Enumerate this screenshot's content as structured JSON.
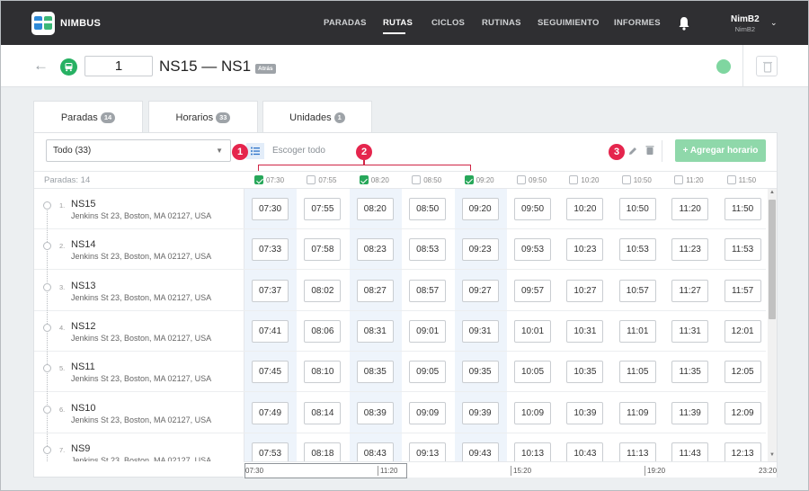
{
  "app": {
    "name": "NIMBUS"
  },
  "nav": {
    "items": [
      "PARADAS",
      "RUTAS",
      "CICLOS",
      "RUTINAS",
      "SEGUIMIENTO",
      "INFORMES"
    ],
    "active": "RUTAS"
  },
  "user": {
    "name": "NimB2",
    "sub": "NimB2"
  },
  "route": {
    "number": "1",
    "name": "NS15 — NS1",
    "direction": "Atrás",
    "status_color": "#7fd6a0"
  },
  "tabs": [
    {
      "label": "Paradas",
      "count": "14"
    },
    {
      "label": "Horarios",
      "count": "33"
    },
    {
      "label": "Unidades",
      "count": "1"
    }
  ],
  "active_tab": "Unidades",
  "toolbar": {
    "filter_value": "Todo (33)",
    "select_all": "Escoger todo",
    "add_label": "+ Agregar horario"
  },
  "markers": [
    "1",
    "2",
    "3"
  ],
  "grid": {
    "stops_label": "Paradas: 14",
    "columns": [
      {
        "time": "07:30",
        "checked": true
      },
      {
        "time": "07:55",
        "checked": false
      },
      {
        "time": "08:20",
        "checked": true
      },
      {
        "time": "08:50",
        "checked": false
      },
      {
        "time": "09:20",
        "checked": true
      },
      {
        "time": "09:50",
        "checked": false
      },
      {
        "time": "10:20",
        "checked": false
      },
      {
        "time": "10:50",
        "checked": false
      },
      {
        "time": "11:20",
        "checked": false
      },
      {
        "time": "11:50",
        "checked": false
      }
    ],
    "stops": [
      {
        "num": "1.",
        "name": "NS15",
        "address": "Jenkins St 23, Boston, MA 02127, USA",
        "times": [
          "07:30",
          "07:55",
          "08:20",
          "08:50",
          "09:20",
          "09:50",
          "10:20",
          "10:50",
          "11:20",
          "11:50"
        ]
      },
      {
        "num": "2.",
        "name": "NS14",
        "address": "Jenkins St 23, Boston, MA 02127, USA",
        "times": [
          "07:33",
          "07:58",
          "08:23",
          "08:53",
          "09:23",
          "09:53",
          "10:23",
          "10:53",
          "11:23",
          "11:53"
        ]
      },
      {
        "num": "3.",
        "name": "NS13",
        "address": "Jenkins St 23, Boston, MA 02127, USA",
        "times": [
          "07:37",
          "08:02",
          "08:27",
          "08:57",
          "09:27",
          "09:57",
          "10:27",
          "10:57",
          "11:27",
          "11:57"
        ]
      },
      {
        "num": "4.",
        "name": "NS12",
        "address": "Jenkins St 23, Boston, MA 02127, USA",
        "times": [
          "07:41",
          "08:06",
          "08:31",
          "09:01",
          "09:31",
          "10:01",
          "10:31",
          "11:01",
          "11:31",
          "12:01"
        ]
      },
      {
        "num": "5.",
        "name": "NS11",
        "address": "Jenkins St 23, Boston, MA 02127, USA",
        "times": [
          "07:45",
          "08:10",
          "08:35",
          "09:05",
          "09:35",
          "10:05",
          "10:35",
          "11:05",
          "11:35",
          "12:05"
        ]
      },
      {
        "num": "6.",
        "name": "NS10",
        "address": "Jenkins St 23, Boston, MA 02127, USA",
        "times": [
          "07:49",
          "08:14",
          "08:39",
          "09:09",
          "09:39",
          "10:09",
          "10:39",
          "11:09",
          "11:39",
          "12:09"
        ]
      },
      {
        "num": "7.",
        "name": "NS9",
        "address": "Jenkins St 23, Boston, MA 02127, USA",
        "times": [
          "07:53",
          "08:18",
          "08:43",
          "09:13",
          "09:43",
          "10:13",
          "10:43",
          "11:13",
          "11:43",
          "12:13"
        ]
      }
    ]
  },
  "timeline": {
    "labels": [
      "07:30",
      "11:20",
      "15:20",
      "19:20",
      "23:20"
    ]
  },
  "colors": {
    "accent_green": "#27b163",
    "marker_red": "#e5254d",
    "nav_bg": "#2f2f32",
    "add_button": "#8fd8aa",
    "highlight_column": "#eef4fb"
  }
}
